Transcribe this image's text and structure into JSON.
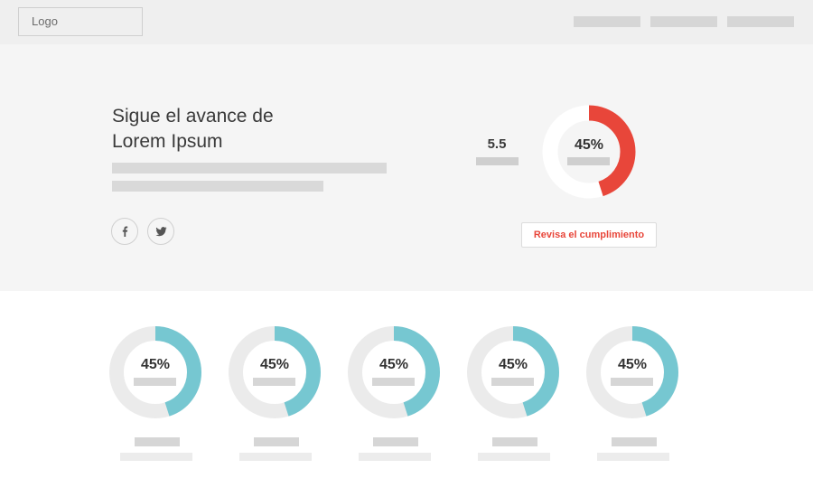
{
  "header": {
    "logo": "Logo",
    "nav_items": [
      "",
      "",
      ""
    ]
  },
  "hero": {
    "title": "Sigue el avance de\nLorem Ipsum",
    "social": [
      {
        "icon": "facebook-icon"
      },
      {
        "icon": "twitter-icon"
      }
    ],
    "stat_value": "5.5",
    "main_progress": {
      "label": "45%",
      "value": 0.45,
      "color": "#e8463a",
      "track": "#ffffff"
    },
    "cta_label": "Revisa el cumplimiento"
  },
  "cards": [
    {
      "label": "45%",
      "value": 0.45
    },
    {
      "label": "45%",
      "value": 0.45
    },
    {
      "label": "45%",
      "value": 0.45
    },
    {
      "label": "45%",
      "value": 0.45
    },
    {
      "label": "45%",
      "value": 0.45
    }
  ],
  "colors": {
    "accent": "#e8463a",
    "progress": "#76c7d1",
    "track": "#ebebeb"
  }
}
